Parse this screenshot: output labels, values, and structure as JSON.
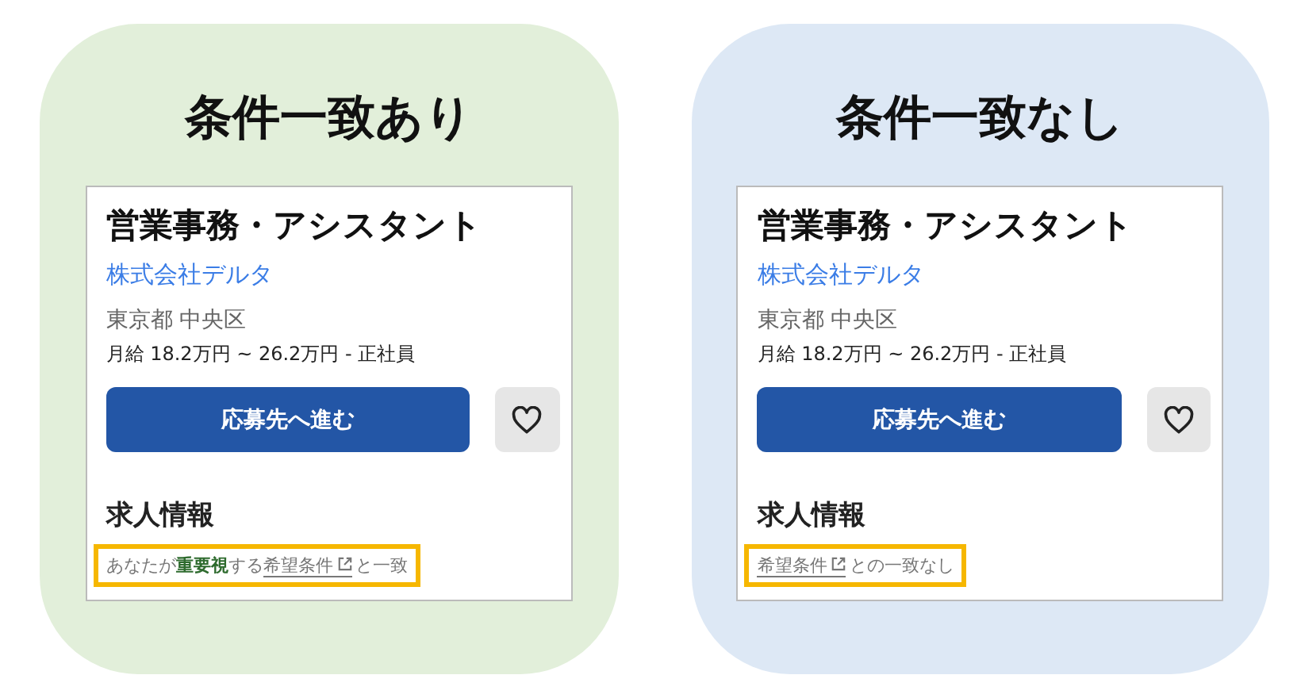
{
  "panels": [
    {
      "heading": "条件一致あり",
      "kind": "match",
      "card": {
        "job_title": "営業事務・アシスタント",
        "company": "株式会社デルタ",
        "location": "東京都 中央区",
        "salary": "月給 18.2万円 ~ 26.2万円  - 正社員",
        "apply_button": "応募先へ進む",
        "section_title": "求人情報",
        "match_note": [
          {
            "kind": "text",
            "text": "あなたが"
          },
          {
            "kind": "emph",
            "text": "重要視"
          },
          {
            "kind": "text",
            "text": "する"
          },
          {
            "kind": "link",
            "text": "希望条件"
          },
          {
            "kind": "text",
            "text": "と一致"
          }
        ]
      }
    },
    {
      "heading": "条件一致なし",
      "kind": "nomatch",
      "card": {
        "job_title": "営業事務・アシスタント",
        "company": "株式会社デルタ",
        "location": "東京都 中央区",
        "salary": "月給 18.2万円 ~ 26.2万円  - 正社員",
        "apply_button": "応募先へ進む",
        "section_title": "求人情報",
        "match_note": [
          {
            "kind": "link",
            "text": "希望条件"
          },
          {
            "kind": "text",
            "text": "との一致なし"
          }
        ]
      }
    }
  ]
}
